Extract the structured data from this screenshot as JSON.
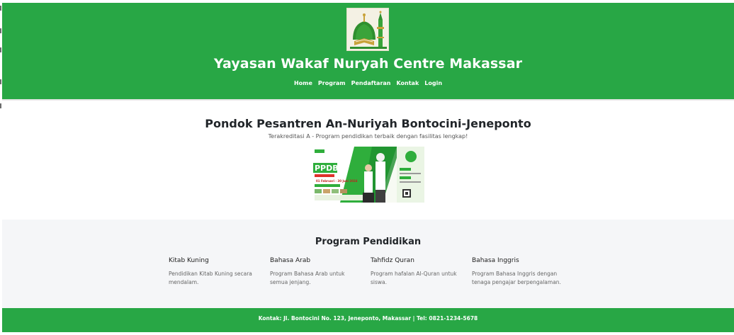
{
  "site": {
    "title": "Yayasan Wakaf Nuryah Centre Makassar",
    "brand_color": "#28a745"
  },
  "nav": {
    "items": [
      "Home",
      "Program",
      "Pendaftaran",
      "Kontak",
      "Login"
    ]
  },
  "hero": {
    "title": "Pondok Pesantren An-Nuriyah Bontocini-Jeneponto",
    "subtitle": "Terakreditasi A - Program pendidikan terbaik dengan fasilitas lengkap!",
    "banner": {
      "badge": "PPDB",
      "dates": "01 Februari - 30 Juni 2024"
    }
  },
  "programs": {
    "title": "Program Pendidikan",
    "items": [
      {
        "name": "Kitab Kuning",
        "desc": "Pendidikan Kitab Kuning secara mendalam."
      },
      {
        "name": "Bahasa Arab",
        "desc": "Program Bahasa Arab untuk semua jenjang."
      },
      {
        "name": "Tahfidz Quran",
        "desc": "Program hafalan Al-Quran untuk siswa."
      },
      {
        "name": "Bahasa Inggris",
        "desc": "Program Bahasa Inggris dengan tenaga pengajar berpengalaman."
      }
    ]
  },
  "footer": {
    "text": "Kontak: Jl. Bontocini No. 123, Jeneponto, Makassar | Tel: 0821-1234-5678"
  }
}
